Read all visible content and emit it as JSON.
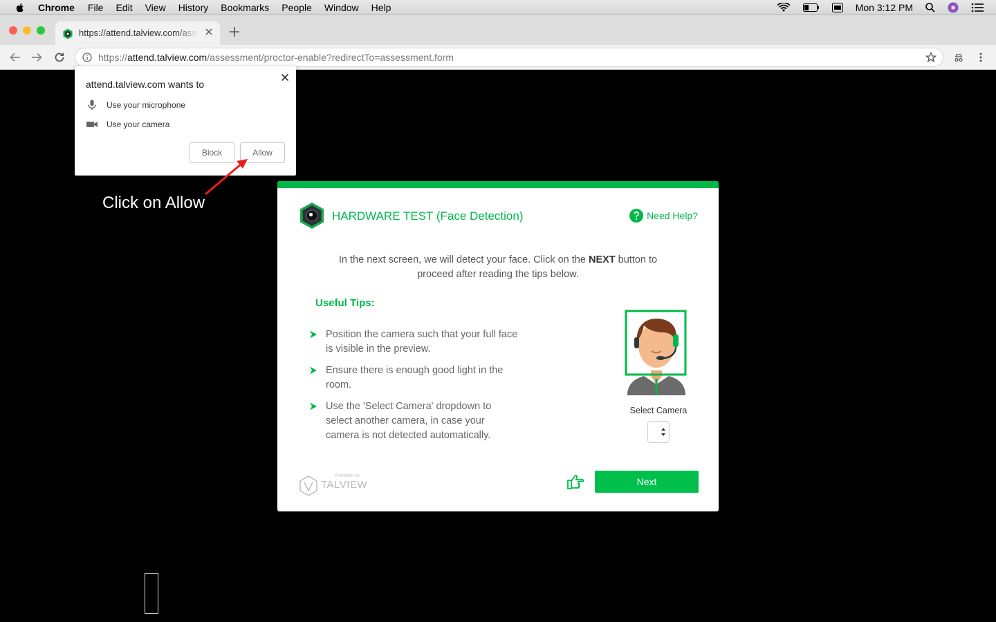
{
  "menubar": {
    "app": "Chrome",
    "items": [
      "File",
      "Edit",
      "View",
      "History",
      "Bookmarks",
      "People",
      "Window",
      "Help"
    ],
    "clock": "Mon 3:12 PM"
  },
  "tab": {
    "title": "https://attend.talview.com/assessment/proctor-enable"
  },
  "address_bar": {
    "scheme": "https://",
    "host": "attend.talview.com",
    "path": "/assessment/proctor-enable?redirectTo=assessment.form"
  },
  "permission_prompt": {
    "title": "attend.talview.com wants to",
    "items": [
      {
        "label": "Use your microphone",
        "icon": "microphone-icon"
      },
      {
        "label": "Use your camera",
        "icon": "camera-icon"
      }
    ],
    "block_label": "Block",
    "allow_label": "Allow"
  },
  "annotation": {
    "text": "Click on Allow",
    "arrow_color": "#e8201c"
  },
  "card": {
    "title": "HARDWARE TEST (Face Detection)",
    "help_label": "Need Help?",
    "intro_before": "In the next screen, we will detect your face. Click on the ",
    "intro_bold": "NEXT",
    "intro_after": " button to proceed after reading the tips below.",
    "tips_heading": "Useful Tips:",
    "tips": [
      "Position the camera such that your full face is visible in the preview.",
      "Ensure there is enough good light in the room.",
      "Use the 'Select Camera' dropdown to select another camera, in case your camera is not detected automatically."
    ],
    "select_camera_label": "Select Camera",
    "select_camera_value": "",
    "powered_by": "POWERED BY",
    "brand": "TALVIEW",
    "next_label": "Next",
    "accent_color": "#00b849"
  }
}
